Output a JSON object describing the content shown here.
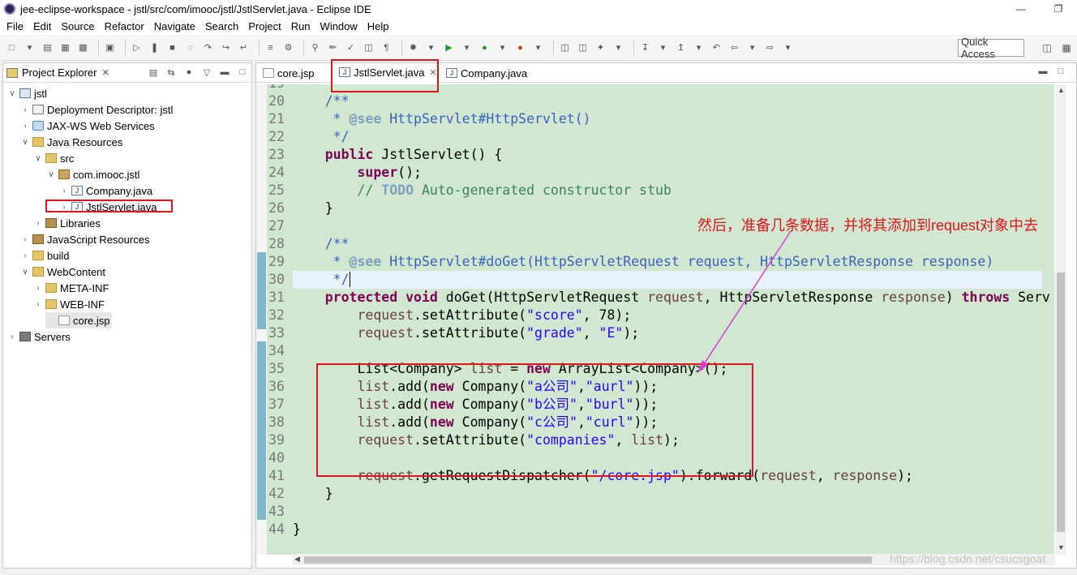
{
  "window": {
    "title": "jee-eclipse-workspace - jstl/src/com/imooc/jstl/JstlServlet.java - Eclipse IDE"
  },
  "menubar": [
    "File",
    "Edit",
    "Source",
    "Refactor",
    "Navigate",
    "Search",
    "Project",
    "Run",
    "Window",
    "Help"
  ],
  "toolbar": {
    "quick_access_label": "Quick Access"
  },
  "project_explorer": {
    "title": "Project Explorer",
    "items": [
      {
        "label": "jstl",
        "icon": "project-icon"
      },
      {
        "label": "Deployment Descriptor: jstl",
        "icon": "deployment-descriptor-icon"
      },
      {
        "label": "JAX-WS Web Services",
        "icon": "web-services-icon"
      },
      {
        "label": "Java Resources",
        "icon": "java-resources-icon"
      },
      {
        "label": "src",
        "icon": "source-folder-icon"
      },
      {
        "label": "com.imooc.jstl",
        "icon": "package-icon"
      },
      {
        "label": "Company.java",
        "icon": "java-file-icon"
      },
      {
        "label": "JstlServlet.java",
        "icon": "java-file-icon"
      },
      {
        "label": "Libraries",
        "icon": "libraries-icon"
      },
      {
        "label": "JavaScript Resources",
        "icon": "javascript-resources-icon"
      },
      {
        "label": "build",
        "icon": "folder-icon"
      },
      {
        "label": "WebContent",
        "icon": "folder-icon"
      },
      {
        "label": "META-INF",
        "icon": "folder-icon"
      },
      {
        "label": "WEB-INF",
        "icon": "folder-icon"
      },
      {
        "label": "core.jsp",
        "icon": "jsp-file-icon"
      },
      {
        "label": "Servers",
        "icon": "servers-icon"
      }
    ]
  },
  "editor": {
    "tabs": [
      {
        "label": "core.jsp",
        "active": false
      },
      {
        "label": "JstlServlet.java",
        "active": true
      },
      {
        "label": "Company.java",
        "active": false
      }
    ],
    "line_numbers": [
      "19",
      "20",
      "21",
      "22",
      "23",
      "24",
      "25",
      "26",
      "27",
      "28",
      "29",
      "30",
      "31",
      "32",
      "33",
      "34",
      "35",
      "36",
      "37",
      "38",
      "39",
      "40",
      "41",
      "42",
      "43",
      "44"
    ],
    "code": {
      "l20": "    /**",
      "l21_pre": "     * ",
      "l21_tag": "@see",
      "l21_rest": " HttpServlet#HttpServlet()",
      "l22": "     */",
      "l23_kw": "public",
      "l23_rest": " JstlServlet() {",
      "l24_kw": "super",
      "l24_rest": "();",
      "l25_pre": "        // ",
      "l25_todo": "TODO",
      "l25_rest": " Auto-generated constructor stub",
      "l26": "    }",
      "l28": "    /**",
      "l29_pre": "     * ",
      "l29_tag": "@see",
      "l29_rest": " HttpServlet#doGet(HttpServletRequest request, HttpServletResponse response)",
      "l30": "     */",
      "l31_kw1": "protected",
      "l31_kw2": "void",
      "l31_a": " doGet(HttpServletRequest ",
      "l31_p1": "request",
      "l31_b": ", HttpServletResponse ",
      "l31_p2": "response",
      "l31_c": ") ",
      "l31_kw3": "throws",
      "l31_d": " Serv",
      "l32_p": "request",
      "l32_a": ".setAttribute(",
      "l32_s": "\"score\"",
      "l32_b": ", 78);",
      "l33_p": "request",
      "l33_a": ".setAttribute(",
      "l33_s1": "\"grade\"",
      "l33_b": ", ",
      "l33_s2": "\"E\"",
      "l33_c": ");",
      "l35_a": "List<Company> ",
      "l35_v": "list",
      "l35_b": " = ",
      "l35_kw": "new",
      "l35_c": " ArrayList<Company>();",
      "l36_v": "list",
      "l36_a": ".add(",
      "l36_kw": "new",
      "l36_b": " Company(",
      "l36_s1": "\"a公司\"",
      "l36_c": ",",
      "l36_s2": "\"aurl\"",
      "l36_d": "));",
      "l37_v": "list",
      "l37_a": ".add(",
      "l37_kw": "new",
      "l37_b": " Company(",
      "l37_s1": "\"b公司\"",
      "l37_c": ",",
      "l37_s2": "\"burl\"",
      "l37_d": "));",
      "l38_v": "list",
      "l38_a": ".add(",
      "l38_kw": "new",
      "l38_b": " Company(",
      "l38_s1": "\"c公司\"",
      "l38_c": ",",
      "l38_s2": "\"curl\"",
      "l38_d": "));",
      "l39_p": "request",
      "l39_a": ".setAttribute(",
      "l39_s": "\"companies\"",
      "l39_b": ", ",
      "l39_v": "list",
      "l39_c": ");",
      "l41_p": "request",
      "l41_a": ".getRequestDispatcher(",
      "l41_s": "\"/core.jsp\"",
      "l41_b": ").forward(",
      "l41_p2": "request",
      "l41_c": ", ",
      "l41_p3": "response",
      "l41_d": ");",
      "l42": "    }",
      "l44": "}"
    }
  },
  "annotation": "然后，准备几条数据，并将其添加到request对象中去",
  "watermark": "https://blog.csdn.net/csucsgoat",
  "colors": {
    "code_background": "#cfe8cf",
    "highlight_box": "#e0141e",
    "keyword": "#7f0055",
    "string": "#2a00ff",
    "comment": "#3f5fbf",
    "arrow": "#d63fd0"
  }
}
